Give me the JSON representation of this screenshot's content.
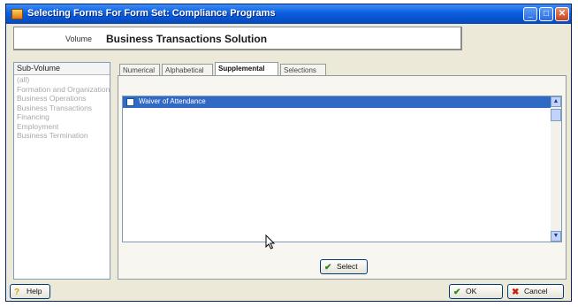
{
  "window": {
    "title": "Selecting Forms For Form Set: Compliance Programs"
  },
  "volume": {
    "label": "Volume",
    "value": "Business Transactions Solution"
  },
  "subvolume": {
    "header": "Sub-Volume",
    "items": [
      "(all)",
      "Formation and Organization",
      "Business Operations",
      "Business Transactions",
      "Financing",
      "Employment",
      "Business Termination"
    ]
  },
  "tabs": [
    "Numerical",
    "Alphabetical",
    "Supplemental",
    "Selections"
  ],
  "active_tab": "Supplemental",
  "forms": [
    {
      "label": "Waiver of Attendance",
      "checked": false,
      "selected": true
    }
  ],
  "buttons": {
    "select": "Select",
    "help": "Help",
    "ok": "OK",
    "cancel": "Cancel"
  },
  "colors": {
    "titlebar": "#0a5ee0",
    "selection": "#316ac5",
    "face": "#ece9d8"
  },
  "icons": {
    "select": "checkmark-icon",
    "ok": "checkmark-icon",
    "cancel": "x-icon",
    "help": "question-icon"
  }
}
